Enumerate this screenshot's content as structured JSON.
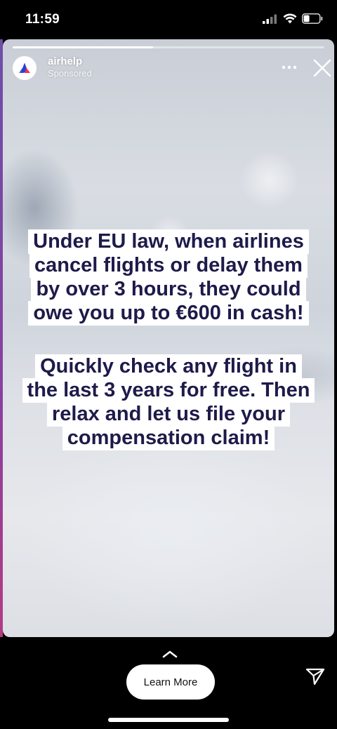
{
  "status_bar": {
    "time": "11:59",
    "icons": [
      "signal-icon",
      "wifi-icon",
      "battery-icon"
    ]
  },
  "story": {
    "progress": 0.45,
    "advertiser": "airhelp",
    "sponsored_label": "Sponsored",
    "text_blocks": [
      {
        "lines": [
          "Under EU law, when airlines",
          "cancel flights or delay them",
          "by over 3 hours, they could",
          "owe you up to €600 in cash!"
        ]
      },
      {
        "lines": [
          "Quickly check any flight in",
          "the last 3 years for free. Then",
          "relax and let us file your",
          "compensation claim!"
        ]
      }
    ]
  },
  "footer": {
    "cta_label": "Learn More"
  },
  "colors": {
    "text_dark": "#1e1a4a",
    "brand_blue": "#2b3fd6",
    "brand_red": "#e5374b"
  }
}
